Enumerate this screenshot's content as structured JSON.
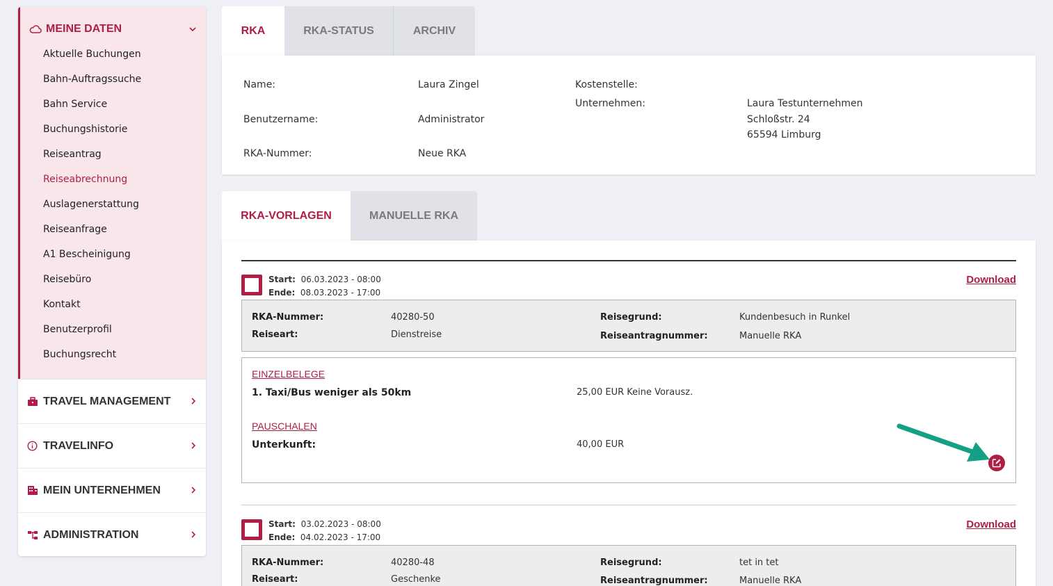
{
  "sidebar": {
    "open_section": {
      "label": "MEINE DATEN",
      "icon": "cloud-icon",
      "items": [
        {
          "label": "Aktuelle Buchungen"
        },
        {
          "label": "Bahn-Auftragssuche"
        },
        {
          "label": "Bahn Service"
        },
        {
          "label": "Buchungshistorie"
        },
        {
          "label": "Reiseantrag"
        },
        {
          "label": "Reiseabrechnung",
          "active": true
        },
        {
          "label": "Auslagenerstattung"
        },
        {
          "label": "Reiseanfrage"
        },
        {
          "label": "A1 Bescheinigung"
        },
        {
          "label": "Reisebüro"
        },
        {
          "label": "Kontakt"
        },
        {
          "label": "Benutzerprofil"
        },
        {
          "label": "Buchungsrecht"
        }
      ]
    },
    "sections": [
      {
        "label": "TRAVEL MANAGEMENT",
        "icon": "briefcase-icon"
      },
      {
        "label": "TRAVELINFO",
        "icon": "info-circle-icon"
      },
      {
        "label": "MEIN UNTERNEHMEN",
        "icon": "building-icon"
      },
      {
        "label": "ADMINISTRATION",
        "icon": "sitemap-icon"
      }
    ]
  },
  "top_tabs": [
    {
      "label": "RKA",
      "active": true
    },
    {
      "label": "RKA-STATUS"
    },
    {
      "label": "ARCHIV"
    }
  ],
  "info": {
    "name_label": "Name:",
    "name_value": "Laura Zingel",
    "username_label": "Benutzername:",
    "username_value": "Administrator",
    "rka_number_label": "RKA-Nummer:",
    "rka_number_value": "Neue RKA",
    "cost_center_label": "Kostenstelle:",
    "company_label": "Unternehmen:",
    "company_lines": [
      "Laura Testunternehmen",
      "Schloßstr. 24",
      "65594 Limburg"
    ]
  },
  "sub_tabs": [
    {
      "label": "RKA-VORLAGEN",
      "active": true
    },
    {
      "label": "MANUELLE RKA"
    }
  ],
  "labels": {
    "start": "Start:",
    "end": "Ende:",
    "download": "Download",
    "rka_number": "RKA-Nummer:",
    "travel_type": "Reiseart:",
    "travel_reason": "Reisegrund:",
    "request_number": "Reiseantragnummer:",
    "receipts": "EINZELBELEGE",
    "flat_rates": "PAUSCHALEN"
  },
  "entries": [
    {
      "start": "06.03.2023 - 08:00",
      "end": "08.03.2023 - 17:00",
      "rka_number": "40280-50",
      "travel_type": "Dienstreise",
      "travel_reason": "Kundenbesuch in Runkel",
      "request_number": "Manuelle RKA",
      "receipt_item": "1.  Taxi/Bus weniger als 50km",
      "receipt_amount": "25,00 EUR Keine Vorausz.",
      "flat_item": "Unterkunft:",
      "flat_amount": "40,00 EUR"
    },
    {
      "start": "03.02.2023 - 08:00",
      "end": "04.02.2023 - 17:00",
      "rka_number": "40280-48",
      "travel_type": "Geschenke",
      "travel_reason": "tet in tet",
      "request_number": "Manuelle RKA"
    }
  ],
  "colors": {
    "accent": "#b01e45",
    "arrow": "#14a085",
    "background": "#eef0f5"
  }
}
